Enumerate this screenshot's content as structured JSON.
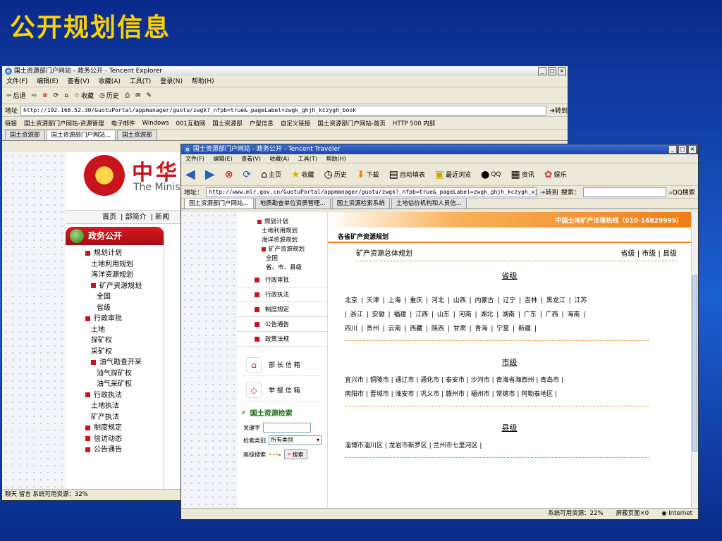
{
  "slide": {
    "title": "公开规划信息"
  },
  "back_window": {
    "title": "国土资源部门户网站 - 政务公开 - Tencent Explorer",
    "menu": [
      "文件(F)",
      "编辑(E)",
      "查看(V)",
      "收藏(A)",
      "工具(T)",
      "登录(N)",
      "帮助(H)"
    ],
    "toolbar": {
      "back": "后退",
      "favorites": "收藏",
      "history": "历史"
    },
    "address_label": "地址",
    "address": "http://192.168.52.30/GuotuPortal/appmanager/guotu/zwgk?_nfpb=true&_pageLabel=zwgk_ghjh_kczygh_book",
    "go_label": "转到",
    "links_label": "链接",
    "links": [
      "国土资源部门户网站-资源管理",
      "电子邮件",
      "Windows",
      "001互助网",
      "国土资源部",
      "户型信息",
      "自定义链接",
      "国土资源部门户网站-首页",
      "HTTP 500 内部"
    ],
    "tabs": [
      "国土资源部",
      "国土资源部门户网站...",
      "国土资源部"
    ],
    "site": {
      "name_cn": "中华人",
      "name_en": "The Ministry"
    },
    "nav": [
      "首页",
      "部简介",
      "新闻"
    ],
    "menu_head": "政务公开",
    "menu_items": [
      {
        "label": "规划计划",
        "level": 0,
        "bullet": true
      },
      {
        "label": "土地利用规划",
        "level": 1,
        "bullet": false
      },
      {
        "label": "海洋资源规划",
        "level": 1,
        "bullet": false
      },
      {
        "label": "矿产资源规划",
        "level": 1,
        "bullet": true
      },
      {
        "label": "全国",
        "level": 2,
        "bullet": false
      },
      {
        "label": "省级",
        "level": 2,
        "bullet": false
      },
      {
        "label": "行政审批",
        "level": 0,
        "bullet": true
      },
      {
        "label": "土地",
        "level": 1,
        "bullet": false
      },
      {
        "label": "探矿权",
        "level": 1,
        "bullet": false
      },
      {
        "label": "采矿权",
        "level": 1,
        "bullet": false
      },
      {
        "label": "油气勘查开采",
        "level": 1,
        "bullet": true
      },
      {
        "label": "油气探矿权",
        "level": 2,
        "bullet": false
      },
      {
        "label": "油气采矿权",
        "level": 2,
        "bullet": false
      },
      {
        "label": "行政执法",
        "level": 0,
        "bullet": true
      },
      {
        "label": "土地执法",
        "level": 1,
        "bullet": false
      },
      {
        "label": "矿产执法",
        "level": 1,
        "bullet": false
      },
      {
        "label": "制度规定",
        "level": 0,
        "bullet": true
      },
      {
        "label": "信访动态",
        "level": 0,
        "bullet": true
      },
      {
        "label": "公告通告",
        "level": 0,
        "bullet": true
      }
    ],
    "status": "聊天   留言   系统可用资源：32%"
  },
  "front_window": {
    "title": "国土资源部门户网站 - 政务公开 - Tencent Traveler",
    "menu": [
      "文件(F)",
      "编辑(E)",
      "查看(V)",
      "收藏(A)",
      "工具(T)",
      "帮助(H)"
    ],
    "toolbar": [
      "主页",
      "收藏",
      "历史",
      "下载",
      "自动填表",
      "最近浏览",
      "QQ",
      "资讯",
      "娱乐"
    ],
    "address_label": "地址：",
    "address": "http://www.mlr.gov.cn/GuotuPortal/appmanager/guotu/zwgk?_nfpb=true&_pageLabel=zwgk_ghjh_kczygh_xj",
    "go_label": "转到",
    "search_label": "搜索：",
    "qq_search": "QQ搜索",
    "tabs": [
      "国土资源部门户网站...",
      "地质勘查单位资质管理...",
      "国土资源检索系统",
      "土地估价机构和人员信..."
    ],
    "sidebar_items": [
      {
        "label": "规划计划",
        "level": 0,
        "bullet": true
      },
      {
        "label": "土地利用规划",
        "level": 1,
        "bullet": false
      },
      {
        "label": "海洋资源规划",
        "level": 1,
        "bullet": false
      },
      {
        "label": "矿产资源规划",
        "level": 1,
        "bullet": true
      },
      {
        "label": "全国",
        "level": 2,
        "bullet": false
      },
      {
        "label": "省、市、县级",
        "level": 2,
        "bullet": false
      }
    ],
    "sidebar_sections": [
      "行政审批",
      "行政执法",
      "制度规定",
      "公告通告",
      "政策法规"
    ],
    "minister_box": "部 长 信 箱",
    "report_box": "举 报 信 箱",
    "search_head": "国土资源检索",
    "keyword_label": "关键字",
    "category_label": "检索类别",
    "category_value": "所有类别",
    "advanced_label": "高级搜索",
    "search_button": "搜索",
    "hotline": "中国土地矿产法律热线（010-16829999）",
    "section_title": "各省矿产资源规划",
    "row_label": "矿产资源总体规划",
    "row_levels": "省级 | 市级 | 县级",
    "province_heading": "省级",
    "provinces_line1": "北京 | 天津 | 上海 | 重庆 | 河北 | 山西 | 内蒙古 | 辽宁 | 吉林 | 黑龙江 | 江苏",
    "provinces_line2": "| 浙江 | 安徽 | 福建 | 江西 | 山东 | 河南 | 湖北 | 湖南 | 广东 | 广西 | 海南 |",
    "provinces_line3": "四川 | 贵州 | 云南 | 西藏 | 陕西 | 甘肃 | 青海 | 宁夏 | 新疆 |",
    "city_heading": "市级",
    "cities_line1": "宜兴市 | 铜陵市 | 通辽市 | 通化市 | 泰安市 | 沙河市 | 青海省海西州 | 青岛市 |",
    "cities_line2": "南阳市 | 晋城市 | 淮安市 | 巩义市 | 赣州市 | 福州市 | 常德市 | 阿勒泰地区 |",
    "county_heading": "县级",
    "counties_line1": "淄博市淄川区 | 龙岩市新罗区 | 兰州市七里河区 |",
    "status_resources": "系统可用资源：22%",
    "status_blocked": "屏蔽页面×0",
    "status_zone": "Internet"
  }
}
